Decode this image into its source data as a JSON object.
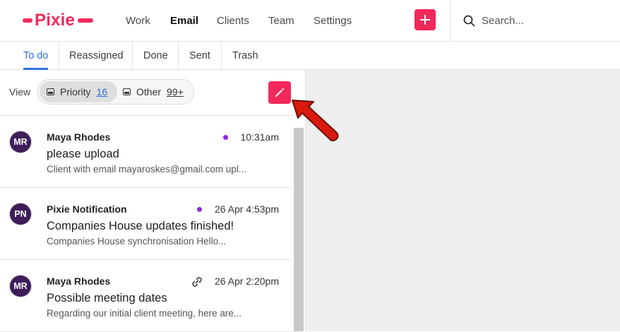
{
  "brand": {
    "name": "Pixie",
    "color": "#f2295b"
  },
  "nav": {
    "items": [
      {
        "label": "Work",
        "active": false
      },
      {
        "label": "Email",
        "active": true
      },
      {
        "label": "Clients",
        "active": false
      },
      {
        "label": "Team",
        "active": false
      },
      {
        "label": "Settings",
        "active": false
      }
    ],
    "add_icon": "plus-icon"
  },
  "search": {
    "placeholder": "Search...",
    "icon": "search-icon"
  },
  "tabs": [
    {
      "label": "To do",
      "active": true
    },
    {
      "label": "Reassigned",
      "active": false
    },
    {
      "label": "Done",
      "active": false
    },
    {
      "label": "Sent",
      "active": false
    },
    {
      "label": "Trash",
      "active": false
    }
  ],
  "view": {
    "label": "View",
    "options": [
      {
        "label": "Priority",
        "count": "16",
        "active": true,
        "icon": "inbox-icon"
      },
      {
        "label": "Other",
        "count": "99+",
        "active": false,
        "icon": "inbox-icon"
      }
    ],
    "compose_icon": "pencil-icon"
  },
  "messages": [
    {
      "initials": "MR",
      "sender": "Maya Rhodes",
      "time": "10:31am",
      "indicator": "unread-dot",
      "subject": "please upload",
      "preview": "Client with email mayaroskes@gmail.com upl..."
    },
    {
      "initials": "PN",
      "sender": "Pixie Notification",
      "time": "26 Apr 4:53pm",
      "indicator": "unread-dot",
      "subject": "Companies House updates finished!",
      "preview": "Companies House synchronisation Hello..."
    },
    {
      "initials": "MR",
      "sender": "Maya Rhodes",
      "time": "26 Apr 2:20pm",
      "indicator": "link-icon",
      "subject": "Possible meeting dates",
      "preview": "Regarding our initial client meeting, here are..."
    }
  ],
  "colors": {
    "accent": "#f2295b",
    "tab_active": "#2f6fde",
    "unread_dot": "#8a2be2",
    "avatar_bg": "#3d1d5a",
    "annotation_arrow": "#d91a0e"
  }
}
